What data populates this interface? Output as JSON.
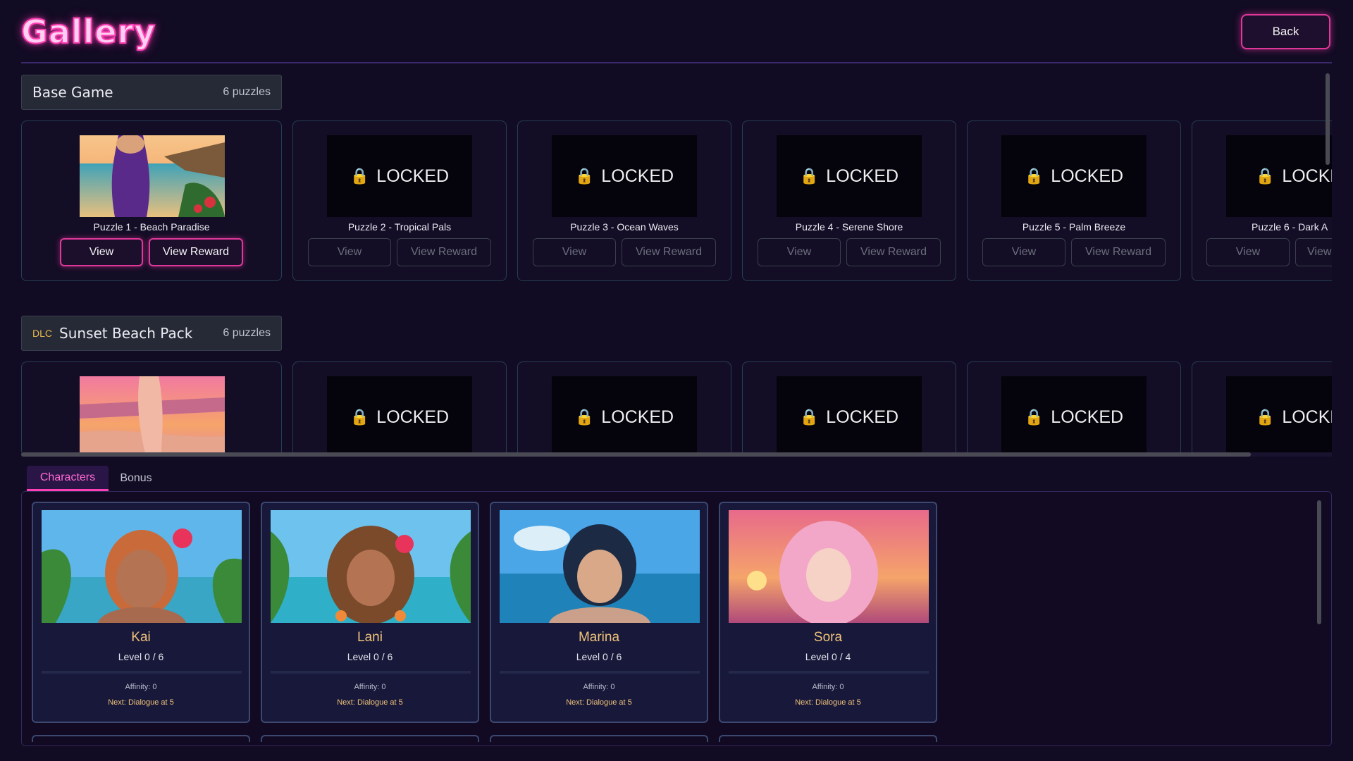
{
  "header": {
    "title": "Gallery",
    "back_label": "Back"
  },
  "packs": [
    {
      "name": "Base Game",
      "dlc_tag": "",
      "count_label": "6 puzzles",
      "puzzles": [
        {
          "title": "Puzzle 1 - Beach Paradise",
          "locked": false,
          "view_label": "View",
          "reward_label": "View Reward"
        },
        {
          "title": "Puzzle 2 - Tropical Pals",
          "locked": true,
          "view_label": "View",
          "reward_label": "View Reward"
        },
        {
          "title": "Puzzle 3 - Ocean Waves",
          "locked": true,
          "view_label": "View",
          "reward_label": "View Reward"
        },
        {
          "title": "Puzzle 4 - Serene Shore",
          "locked": true,
          "view_label": "View",
          "reward_label": "View Reward"
        },
        {
          "title": "Puzzle 5 - Palm Breeze",
          "locked": true,
          "view_label": "View",
          "reward_label": "View Reward"
        },
        {
          "title": "Puzzle 6 - Dark A",
          "locked": true,
          "view_label": "View",
          "reward_label": "View"
        }
      ]
    },
    {
      "name": "Sunset Beach Pack",
      "dlc_tag": "DLC",
      "count_label": "6 puzzles",
      "puzzles": [
        {
          "locked": false
        },
        {
          "locked": true
        },
        {
          "locked": true
        },
        {
          "locked": true
        },
        {
          "locked": true
        },
        {
          "locked": true
        }
      ]
    }
  ],
  "locked_text": "LOCKED",
  "locked_text_cut": "LOCKE",
  "tabs": [
    {
      "label": "Characters",
      "active": true
    },
    {
      "label": "Bonus",
      "active": false
    }
  ],
  "characters": [
    {
      "name": "Kai",
      "level": "Level 0 / 6",
      "affinity": "Affinity: 0",
      "next": "Next: Dialogue at 5"
    },
    {
      "name": "Lani",
      "level": "Level 0 / 6",
      "affinity": "Affinity: 0",
      "next": "Next: Dialogue at 5"
    },
    {
      "name": "Marina",
      "level": "Level 0 / 6",
      "affinity": "Affinity: 0",
      "next": "Next: Dialogue at 5"
    },
    {
      "name": "Sora",
      "level": "Level 0 / 4",
      "affinity": "Affinity: 0",
      "next": "Next: Dialogue at 5"
    }
  ],
  "colors": {
    "accent": "#ff3fb4",
    "lock": "#f5b82e",
    "name": "#f0c27a",
    "background": "#120b24"
  },
  "icons": {
    "lock": "lock-icon"
  }
}
